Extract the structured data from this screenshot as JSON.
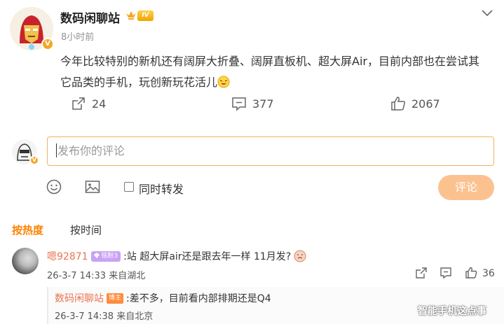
{
  "post": {
    "author": "数码闲聊站",
    "level_badge": "IV",
    "verified_badge": "V",
    "time": "8小时前",
    "content": "今年比较特别的新机还有阔屏大折叠、阔屏直板机、超大屏Air，目前内部也在尝试其它品类的手机，玩创新玩花活儿",
    "shares": "24",
    "comments": "377",
    "likes": "2067"
  },
  "composer": {
    "placeholder": "发布你的评论",
    "repost_label": "同时转发",
    "submit_label": "评论"
  },
  "sort_tabs": {
    "hot": "按热度",
    "time": "按时间"
  },
  "comment": {
    "user": "嗯92871",
    "badge": "铭粉3",
    "text": ":站 超大屏air还是跟去年一样 11月发?",
    "meta": "26-3-7 14:33 来自湖北",
    "likes": "36"
  },
  "reply": {
    "user": "数码闲聊站",
    "badge": "博主",
    "text": ":差不多，目前看内部排期还是Q4",
    "meta": "26-3-7 14:38 来自北京"
  },
  "watermark": "智能手机这点事",
  "colors": {
    "accent": "#ff8200",
    "username": "#eb7350",
    "input_border": "#f0b261",
    "submit_bg": "#fbc290"
  }
}
